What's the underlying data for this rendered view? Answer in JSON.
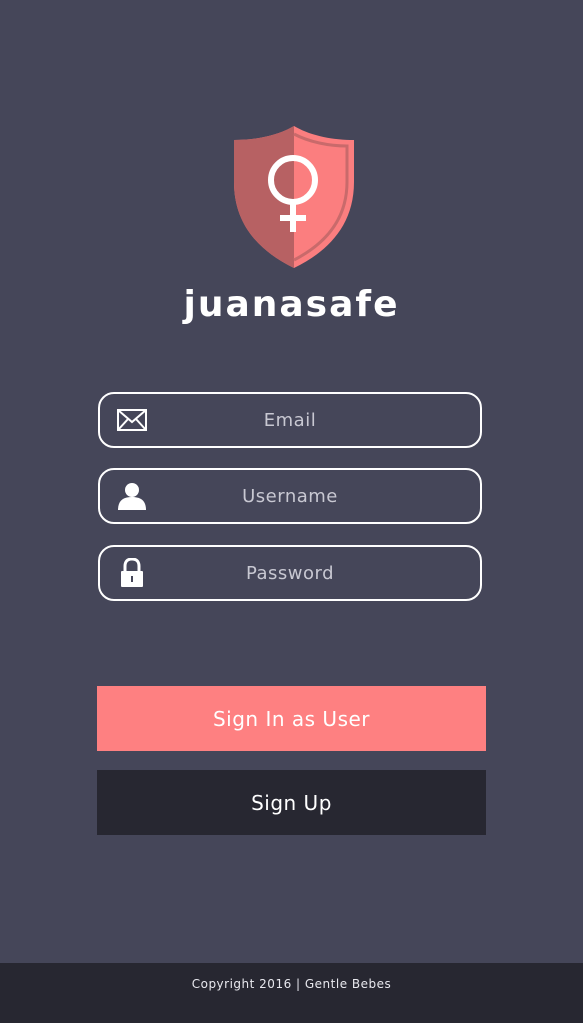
{
  "app": {
    "name": "juanasafe"
  },
  "form": {
    "email_placeholder": "Email",
    "username_placeholder": "Username",
    "password_placeholder": "Password"
  },
  "actions": {
    "signin_label": "Sign In as User",
    "signup_label": "Sign Up"
  },
  "footer": {
    "copyright": "Copyright 2016 | Gentle Bebes"
  },
  "icons": {
    "logo": "shield-female-symbol-icon",
    "email": "envelope-icon",
    "username": "user-icon",
    "password": "lock-icon"
  },
  "colors": {
    "background": "#454659",
    "accent": "#fe8081",
    "dark": "#272731",
    "shield_dark": "#b76163",
    "shield_light": "#fb7e7f",
    "text": "#ffffff"
  }
}
